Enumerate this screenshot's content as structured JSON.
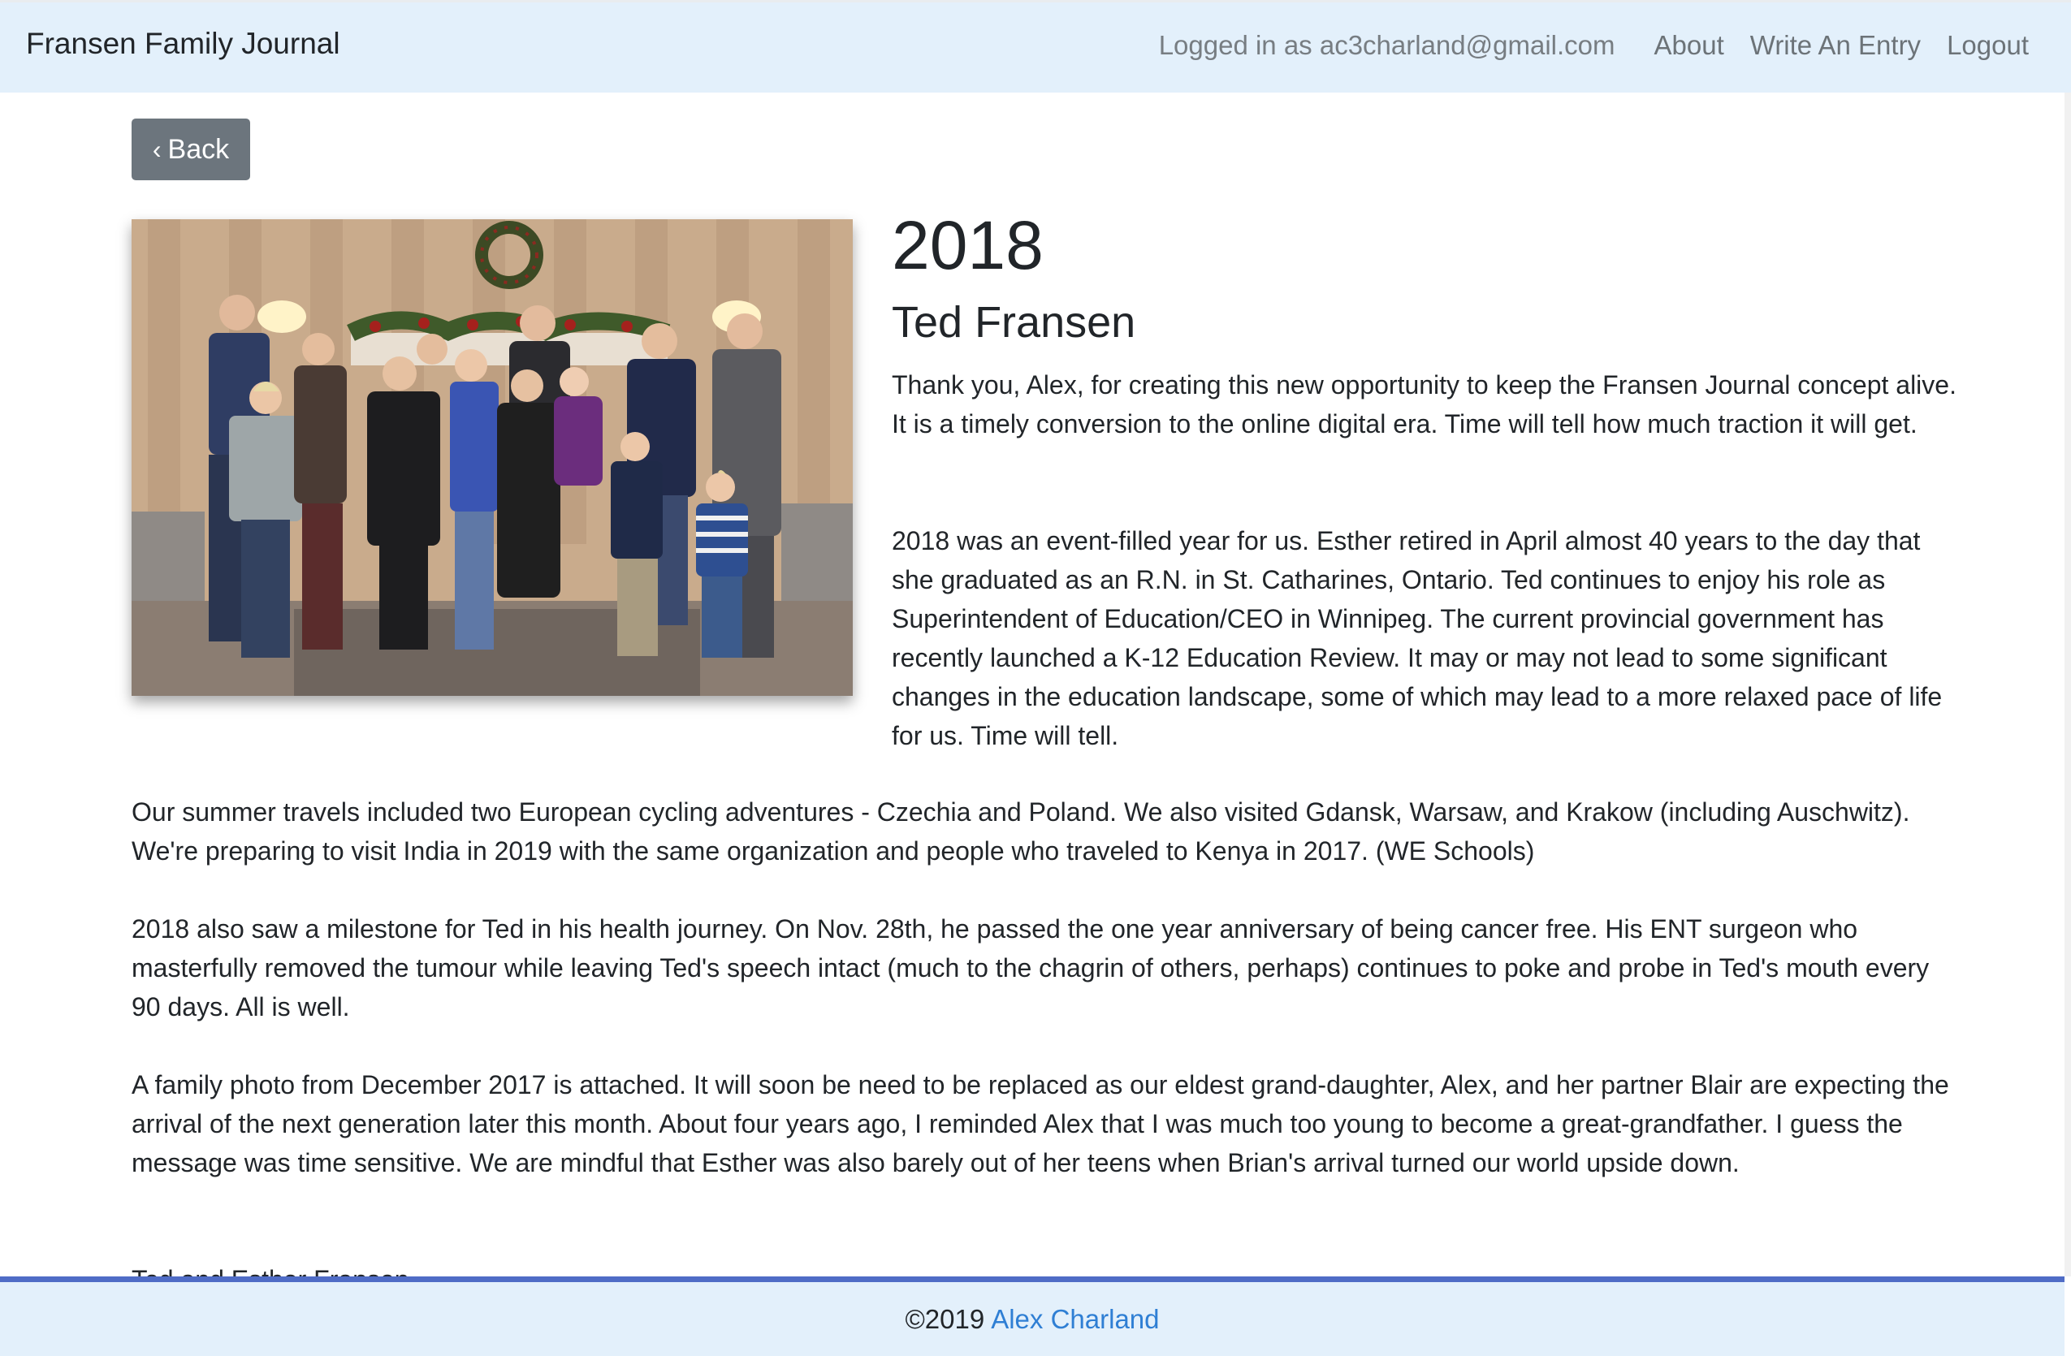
{
  "navbar": {
    "brand": "Fransen Family Journal",
    "logged_in": "Logged in as ac3charland@gmail.com",
    "links": [
      "About",
      "Write An Entry",
      "Logout"
    ]
  },
  "back_button": {
    "icon": "chevron-left-icon",
    "glyph": "‹",
    "label": "Back"
  },
  "entry": {
    "year": "2018",
    "author": "Ted Fransen",
    "paragraphs": [
      "Thank you, Alex, for creating this new opportunity to keep the Fransen Journal concept alive. It is a timely conversion to the online digital era. Time will tell how much traction it will get.",
      "2018 was an event-filled year for us. Esther retired in April almost 40 years to the day that she graduated as an R.N. in St. Catharines, Ontario. Ted continues to enjoy his role as Superintendent of Education/CEO in Winnipeg. The current provincial government has recently launched a K-12 Education Review. It may or may not lead to some significant changes in the education landscape, some of which may lead to a more relaxed pace of life for us. Time will tell.",
      "Our summer travels included two European cycling adventures - Czechia and Poland. We also visited Gdansk, Warsaw, and Krakow (including Auschwitz). We're preparing to visit India in 2019 with the same organization and people who traveled to Kenya in 2017. (WE Schools)",
      "2018 also saw a milestone for Ted in his health journey. On Nov. 28th, he passed the one year anniversary of being cancer free. His ENT surgeon who masterfully removed the tumour while leaving Ted's speech intact (much to the chagrin of others, perhaps) continues to poke and probe in Ted's mouth every 90 days. All is well.",
      "A family photo from December 2017 is attached. It will soon be need to be replaced as our eldest grand-daughter, Alex, and her partner Blair are expecting the arrival of the next generation later this month. About four years ago, I reminded Alex that I was much too young to become a great-grandfather. I guess the message was time sensitive. We are mindful that Esther was also barely out of her teens when Brian's arrival turned our world upside down.",
      "Ted and Esther Fransen"
    ]
  },
  "footer": {
    "copyright": "©2019",
    "author_link": "Alex Charland"
  },
  "colors": {
    "navbar_bg": "#e3f0fb",
    "button_bg": "#6c757d",
    "footer_border": "#4f6cc6",
    "link": "#2f7fd4"
  }
}
